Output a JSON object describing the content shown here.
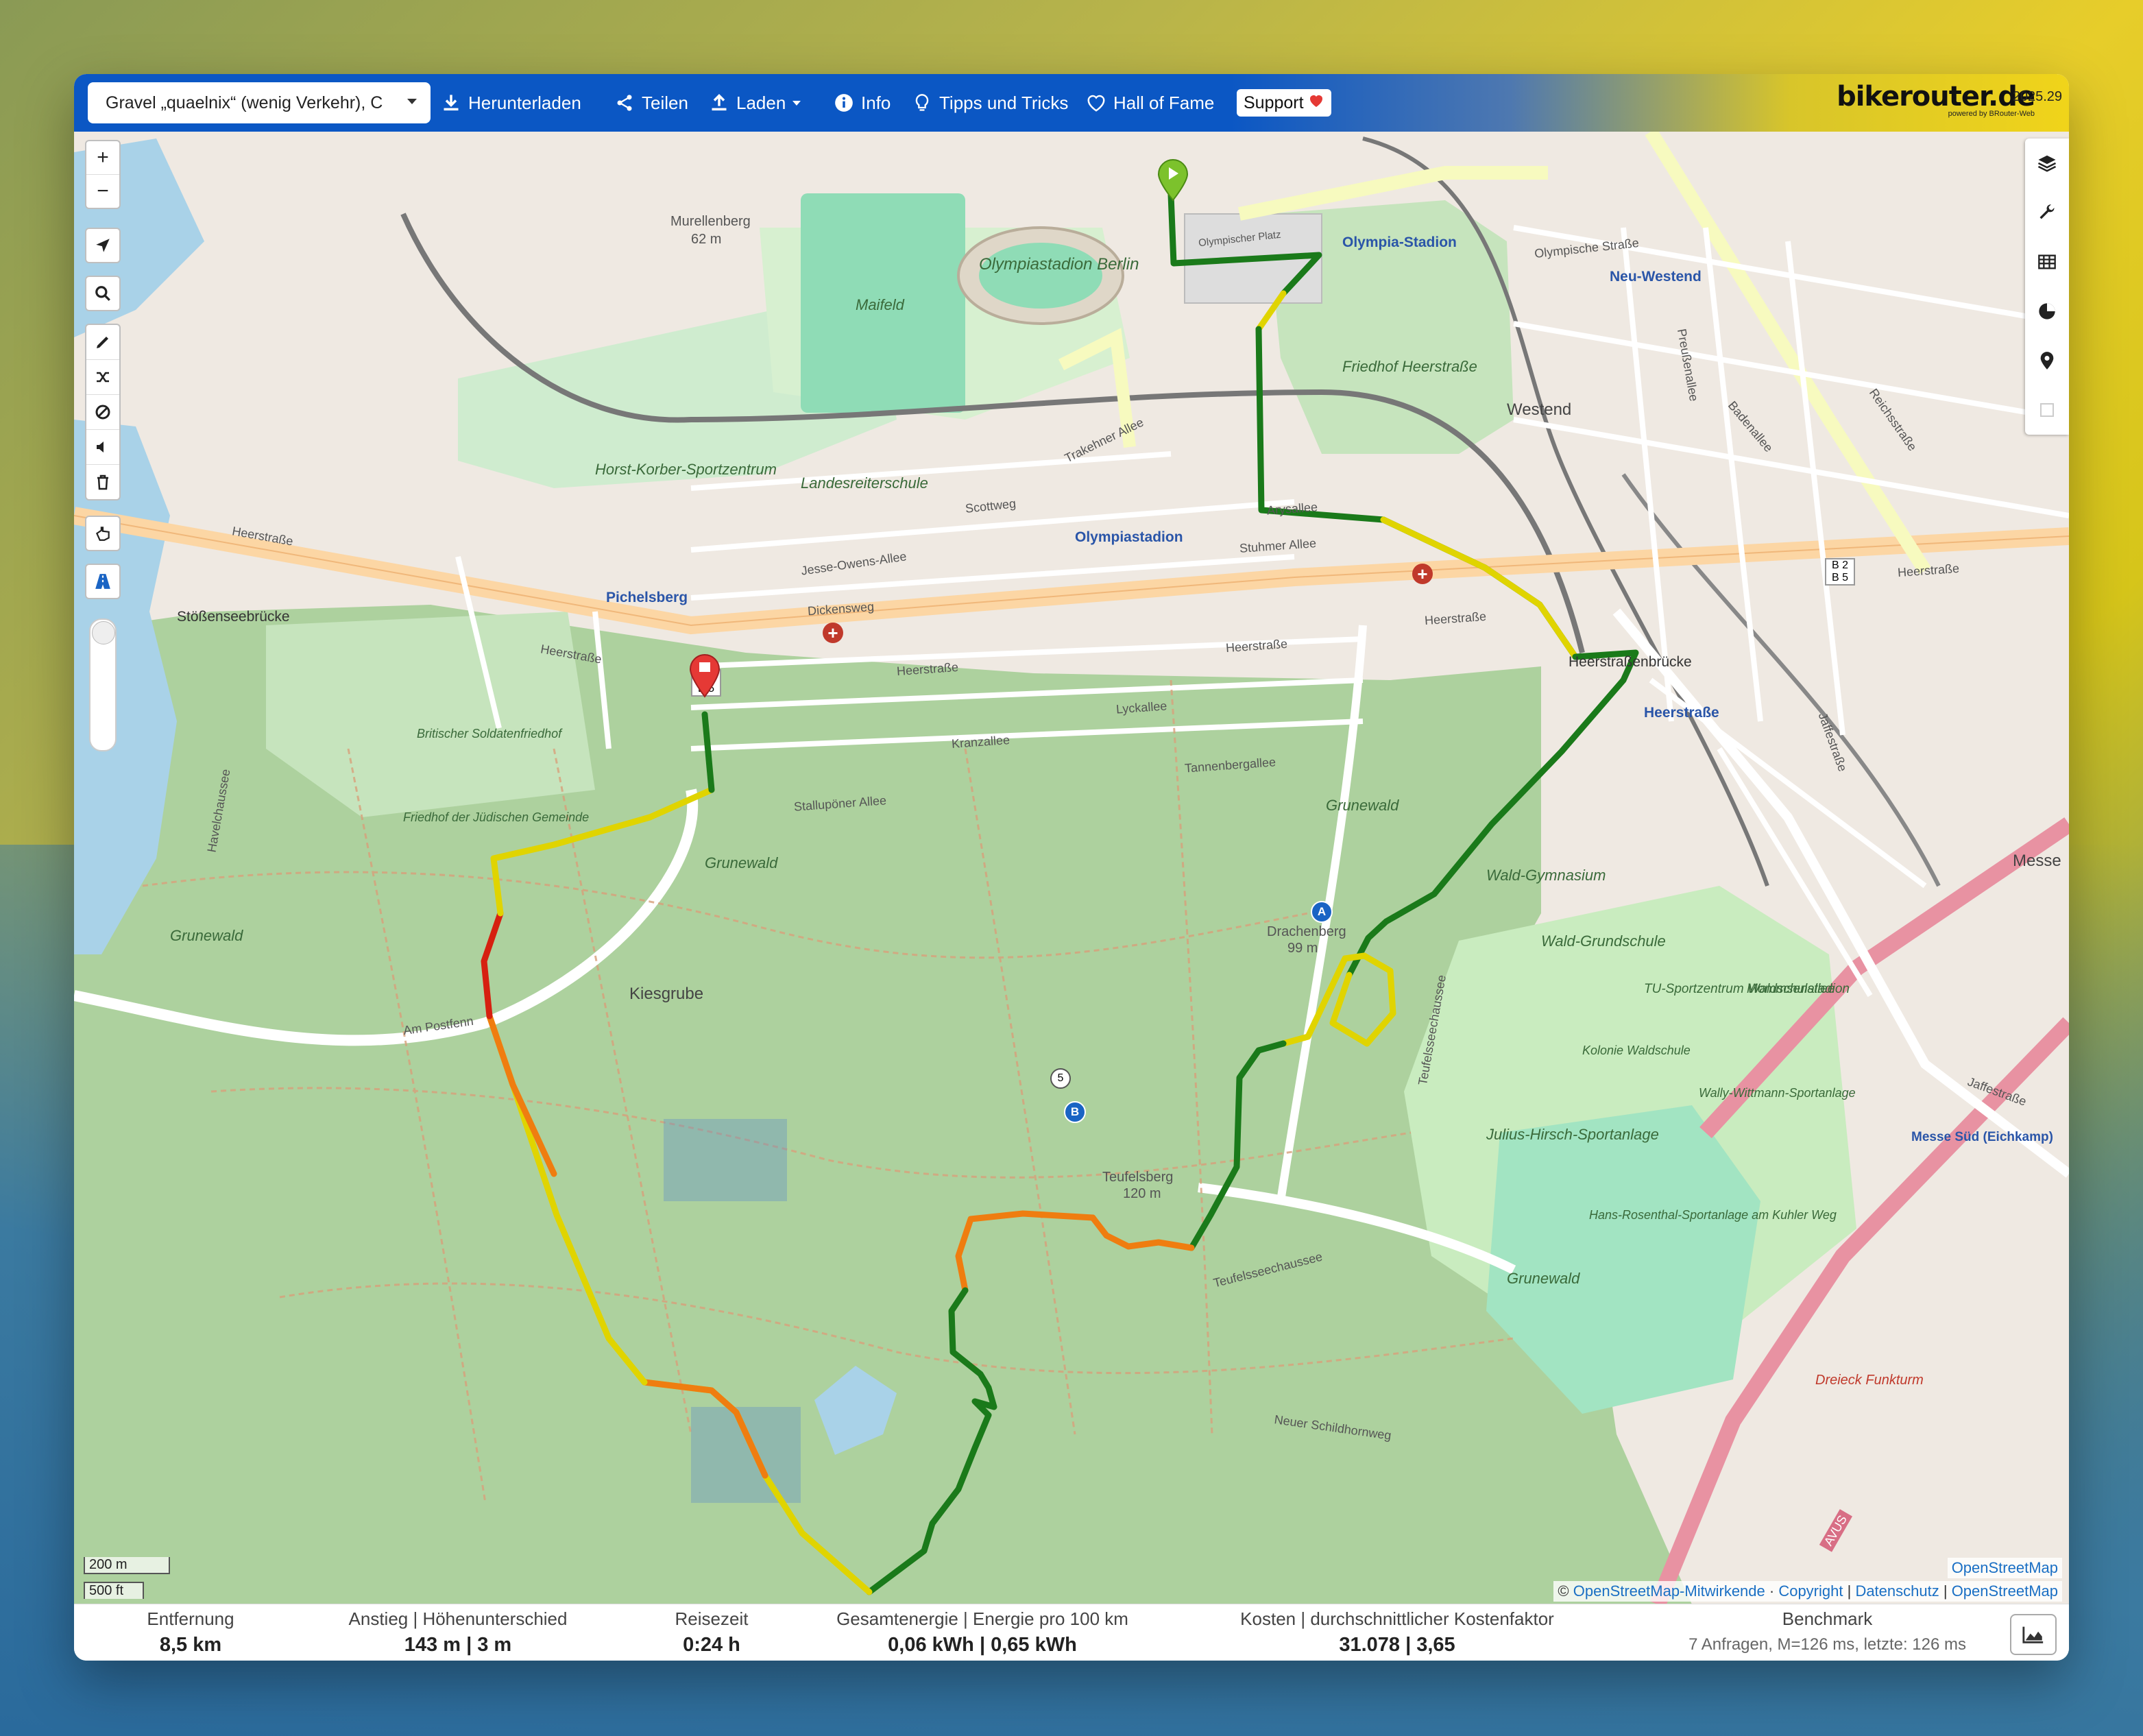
{
  "topbar": {
    "profile": "Gravel „quaelnix“ (wenig Verkehr), C",
    "menu": [
      {
        "label": "Herunterladen",
        "icon": "download-icon"
      },
      {
        "label": "Teilen",
        "icon": "share-icon"
      },
      {
        "label": "Laden",
        "icon": "upload-icon"
      },
      {
        "label": "Info",
        "icon": "info-icon"
      },
      {
        "label": "Tipps und Tricks",
        "icon": "lightbulb-icon"
      },
      {
        "label": "Hall of Fame",
        "icon": "heart-icon"
      }
    ],
    "support": "Support",
    "brand": "bikerouter.de",
    "brand_sub": "powered by BRouter-Web",
    "version": "2025.29"
  },
  "map": {
    "labels": {
      "olympiastadion": "Olympiastadion Berlin",
      "maifeld": "Maifeld",
      "murellenberg": "Murellenberg",
      "murellenberg_ele": "62 m",
      "horst_korber": "Horst-Korber-Sportzentrum",
      "landesreiterschule": "Landesreiterschule",
      "friedhof_heerstrasse": "Friedhof Heerstraße",
      "westend": "Westend",
      "olympia_stadion_station": "Olympia-Stadion",
      "neu_westend": "Neu-Westend",
      "olympiastadion_station": "Olympiastadion",
      "pichelsberg": "Pichelsberg",
      "stoessensee": "Stößenseebrücke",
      "heerstrassenbruecke": "Heerstraßenbrücke",
      "heerstrasse_station": "Heerstraße",
      "britischer": "Britischer Soldatenfriedhof",
      "juedisch": "Friedhof der Jüdischen Gemeinde",
      "kiesgrube": "Kiesgrube",
      "drachenberg": "Drachenberg",
      "drachenberg_ele": "99 m",
      "teufelsberg": "Teufelsberg",
      "teufelsberg_ele": "120 m",
      "grunewald1": "Grunewald",
      "grunewald2": "Grunewald",
      "grunewald3": "Grunewald",
      "grunewald4": "Grunewald",
      "wald_gymnasium": "Wald-Gymnasium",
      "wald_grundschule": "Wald-Grundschule",
      "tu_sport": "TU-Sportzentrum Waldschulallee",
      "mommsen": "Mommsenstadion",
      "kolonie": "Kolonie Waldschule",
      "wally": "Wally-Wittmann-Sportanlage",
      "julius": "Julius-Hirsch-Sportanlage",
      "hans": "Hans-Rosenthal-Sportanlage am Kuhler Weg",
      "messe": "Messe",
      "messe_sued": "Messe Süd (Eichkamp)",
      "dreieck": "Dreieck Funkturm",
      "heerstrasse_a": "Heerstraße",
      "heerstrasse_b": "Heerstraße",
      "heerstrasse_c": "Heerstraße",
      "heerstrasse_d": "Heerstraße",
      "heerstrasse_e": "Heerstraße",
      "heerstrasse_f": "Heerstraße",
      "jesse_owens": "Jesse-Owens-Allee",
      "trakehner": "Trakehner Allee",
      "olympische_strasse": "Olympische Straße",
      "olympischer_platz": "Olympischer Platz",
      "am_postfenn": "Am Postfenn",
      "teufelsseechaussee": "Teufelsseechaussee",
      "teufelsseechaussee2": "Teufelsseechaussee",
      "neuer_schildhornweg": "Neuer Schildhornweg",
      "jaffestrasse": "Jaffestraße",
      "jaffestrasse2": "Jaffestraße",
      "reichsstrasse": "Reichsstraße",
      "havelchaussee": "Havelchaussee",
      "kranzallee": "Kranzallee",
      "tannenbergallee": "Tannenbergallee",
      "lyckallee": "Lyckallee",
      "stalluponer": "Stallupöner Allee",
      "dickensweg": "Dickensweg",
      "scottweg": "Scottweg",
      "arysallee": "Arysallee",
      "stuhmer": "Stuhmer Allee",
      "badenallee": "Badenallee",
      "preussenallee": "Preußenallee",
      "avus": "AVUS",
      "b2b5": "B 2\nB 5",
      "wp5": "5",
      "wpA": "A",
      "wpB": "B"
    },
    "scale_m": "200 m",
    "scale_ft": "500 ft",
    "osm_link": "OpenStreetMap",
    "attribution": {
      "prefix": "©",
      "contributors": "OpenStreetMap-Mitwirkende",
      "copyright": "Copyright",
      "privacy": "Datenschutz",
      "osm": "OpenStreetMap"
    },
    "left_controls": [
      "zoom-in-icon",
      "zoom-out-icon",
      "locate-icon",
      "search-icon",
      "draw-icon",
      "reverse-route-icon",
      "no-go-icon",
      "voice-icon",
      "delete-icon",
      "hand-icon",
      "road-icon"
    ],
    "right_controls": [
      "layers-icon",
      "wrench-icon",
      "table-icon",
      "pie-chart-icon",
      "pin-icon",
      "export-icon"
    ],
    "zoom_in": "+",
    "zoom_out": "−"
  },
  "stats": {
    "distance": {
      "label": "Entfernung",
      "value": "8,5 km"
    },
    "ascent": {
      "label": "Anstieg | Höhenunterschied",
      "value": "143 m | 3 m"
    },
    "time": {
      "label": "Reisezeit",
      "value": "0:24 h"
    },
    "energy": {
      "label": "Gesamtenergie | Energie pro 100 km",
      "value": "0,06 kWh | 0,65 kWh"
    },
    "cost": {
      "label": "Kosten | durchschnittlicher Kostenfaktor",
      "value": "31.078 | 3,65"
    },
    "benchmark": {
      "label": "Benchmark",
      "value": "7 Anfragen, M=126 ms, letzte: 126 ms"
    }
  },
  "colors": {
    "topbar_blue": "#0b57c4",
    "route_green": "#1a7a1a",
    "route_yellow": "#e0d400",
    "route_orange": "#ef7d10",
    "route_red": "#d62010",
    "forest": "#add19e"
  }
}
